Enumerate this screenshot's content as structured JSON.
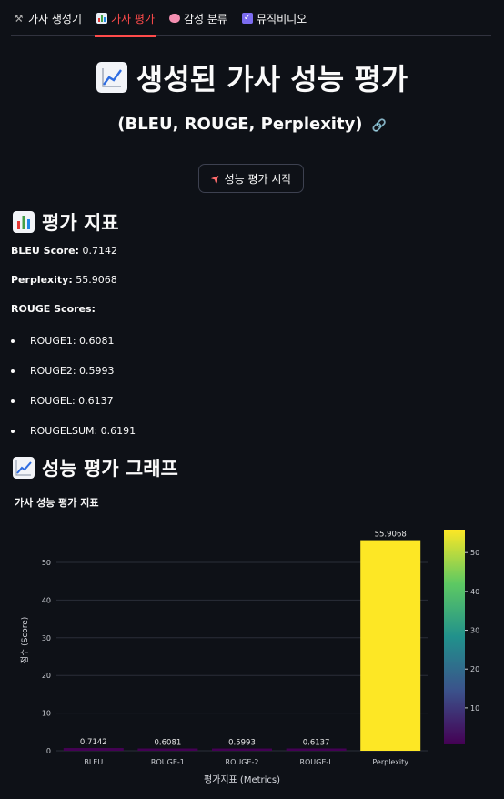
{
  "tabs": [
    {
      "label": "가사 생성기",
      "icon": "hammer-icon"
    },
    {
      "label": "가사 평가",
      "icon": "bar-chart-icon"
    },
    {
      "label": "감성 분류",
      "icon": "brain-icon"
    },
    {
      "label": "뮤직비디오",
      "icon": "checkbox-icon"
    }
  ],
  "title": "생성된 가사 성능 평가",
  "subtitle": "(BLEU, ROUGE, Perplexity)",
  "start_button": "성능 평가 시작",
  "metrics_header": "평가 지표",
  "bleu": {
    "label": "BLEU Score:",
    "value": "0.7142"
  },
  "perplexity": {
    "label": "Perplexity:",
    "value": "55.9068"
  },
  "rouge_header": "ROUGE Scores:",
  "rouge_items": [
    "ROUGE1: 0.6081",
    "ROUGE2: 0.5993",
    "ROUGEL: 0.6137",
    "ROUGELSUM: 0.6191"
  ],
  "graph_header": "성능 평가 그래프",
  "colors": {
    "accent": "#ff4b4b",
    "background": "#0e1117",
    "text": "#fafafa"
  },
  "chart_data": {
    "type": "bar",
    "title": "가사 성능 평가 지표",
    "xlabel": "평가지표 (Metrics)",
    "ylabel": "점수 (Score)",
    "categories": [
      "BLEU",
      "ROUGE-1",
      "ROUGE-2",
      "ROUGE-L",
      "Perplexity"
    ],
    "values": [
      0.7142,
      0.6081,
      0.5993,
      0.6137,
      55.9068
    ],
    "data_labels": [
      "0.7142",
      "0.6081",
      "0.5993",
      "0.6137",
      "55.9068"
    ],
    "ylim": [
      0,
      58.7
    ],
    "yticks": [
      0,
      10,
      20,
      30,
      40,
      50
    ],
    "colorscale": "viridis",
    "colorbar_ticks": [
      10,
      20,
      30,
      40,
      50
    ],
    "colorbar_range": [
      0.5993,
      55.9068
    ],
    "grid": true
  }
}
